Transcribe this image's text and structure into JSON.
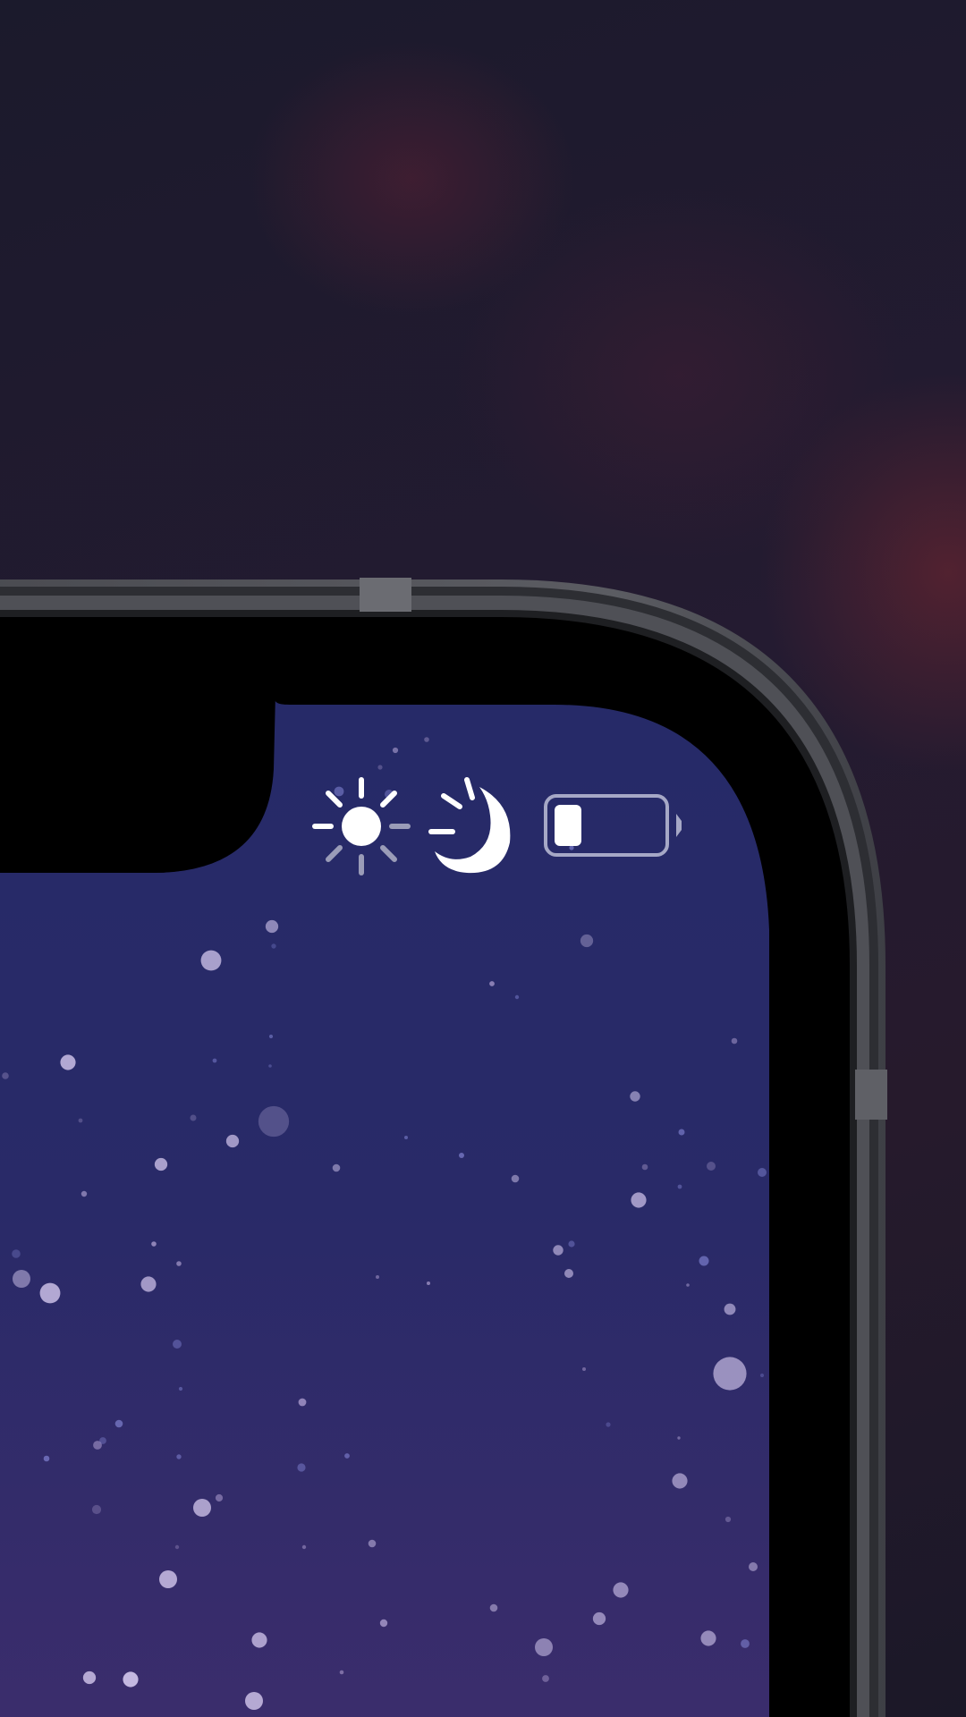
{
  "status_bar": {
    "icons": [
      {
        "name": "brightness-sun-icon",
        "semantic": "sun"
      },
      {
        "name": "night-mode-moon-icon",
        "semantic": "moon"
      },
      {
        "name": "battery-icon",
        "semantic": "battery",
        "level": 0.2
      }
    ]
  },
  "colors": {
    "background": "#1f1a2e",
    "frame": "#55565c",
    "bezel": "#000000",
    "screen_top": "#262a66",
    "screen_bottom": "#3a2c6c",
    "icon": "#ffffff",
    "battery_outline": "#a6a8c6"
  }
}
